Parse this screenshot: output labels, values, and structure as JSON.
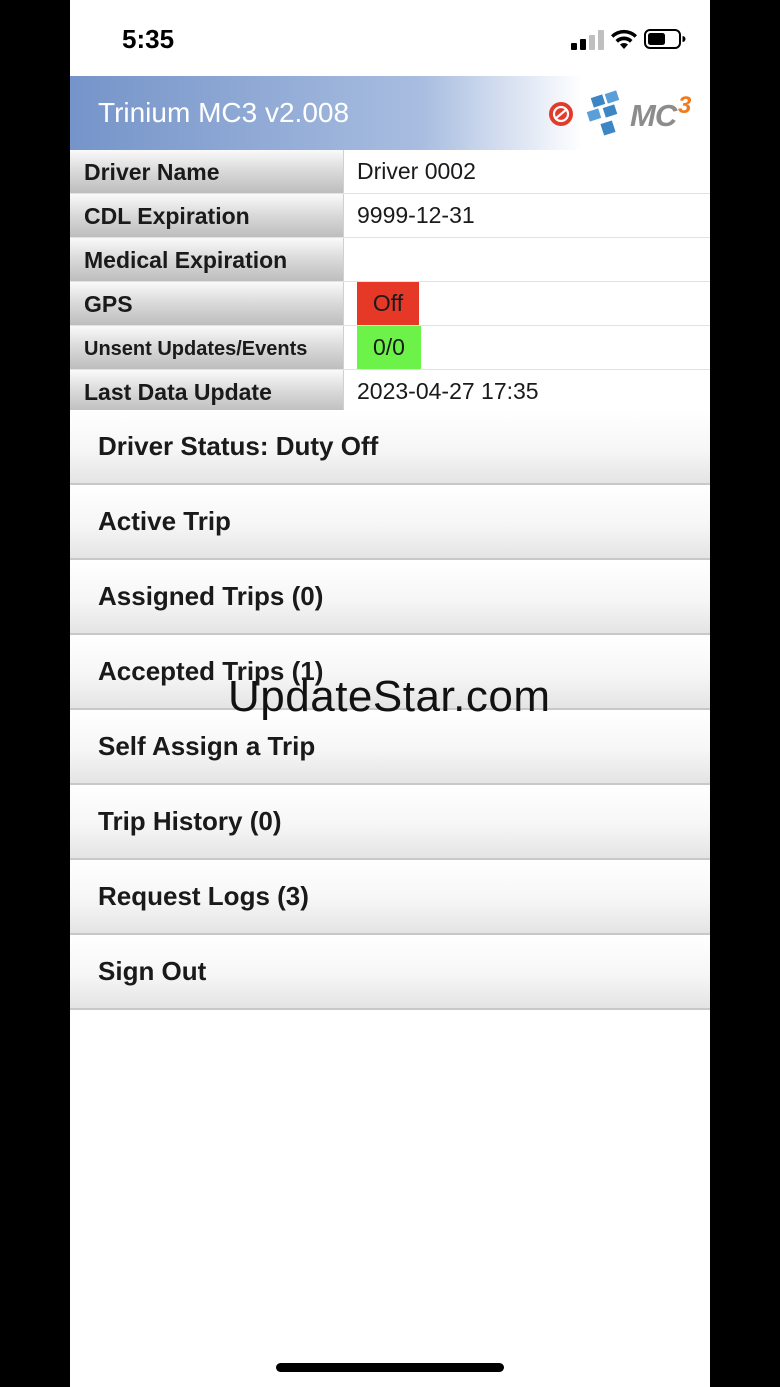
{
  "status_bar": {
    "time": "5:35"
  },
  "app": {
    "title": "Trinium MC3 v2.008",
    "logo_text": "MC",
    "logo_sup": "3"
  },
  "info": {
    "rows": [
      {
        "label": "Driver Name",
        "value": "Driver 0002"
      },
      {
        "label": "CDL Expiration",
        "value": "9999-12-31"
      },
      {
        "label": "Medical Expiration",
        "value": ""
      },
      {
        "label": "GPS",
        "value": "Off",
        "status_color": "#e53826"
      },
      {
        "label": "Unsent Updates/Events",
        "value": "0/0",
        "status_color": "#6df24a"
      },
      {
        "label": "Last Data Update",
        "value": "2023-04-27 17:35"
      }
    ]
  },
  "menu": {
    "items": [
      {
        "label": "Driver Status: Duty Off"
      },
      {
        "label": "Active Trip"
      },
      {
        "label": "Assigned Trips (0)"
      },
      {
        "label": "Accepted Trips (1)"
      },
      {
        "label": "Self Assign a Trip"
      },
      {
        "label": "Trip History (0)"
      },
      {
        "label": "Request Logs (3)"
      },
      {
        "label": "Sign Out"
      }
    ]
  },
  "watermark": "UpdateStar.com",
  "colors": {
    "header_start": "#7594c9",
    "gps_off": "#e53826",
    "updates_ok": "#6df24a",
    "logo_accent": "#f07a1c",
    "logo_blue": "#3d86c6"
  },
  "icons": {
    "alert": "no-signal-alert-icon",
    "logo": "mc3-logo"
  }
}
